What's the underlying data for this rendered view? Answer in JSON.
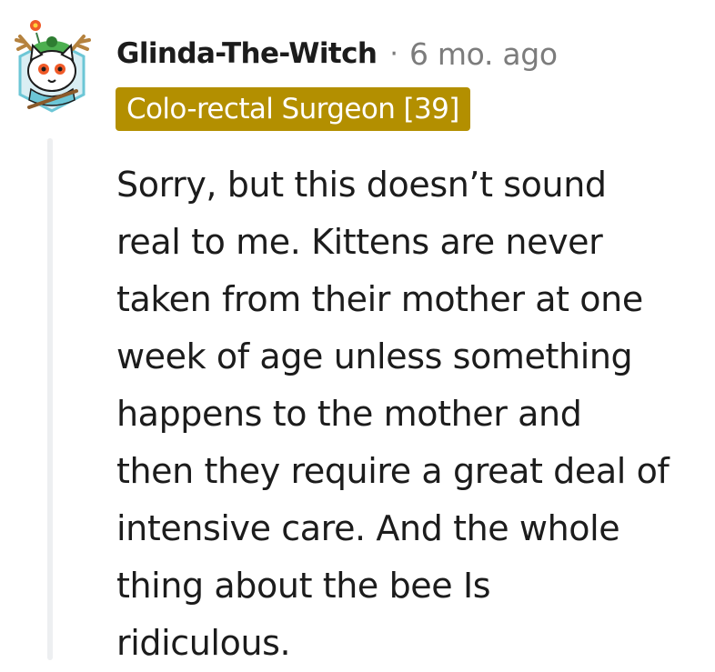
{
  "comment": {
    "author": "Glinda-The-Witch",
    "separator": "·",
    "timestamp": "6 mo. ago",
    "flair": "Colo-rectal Surgeon [39]",
    "body_lines": [
      "Sorry, but this doesn’t sound",
      "real to me. Kittens are never",
      "taken from their mother at one",
      "week of age unless something",
      "happens to the mother and",
      "then they require a great deal of",
      "intensive care. And the whole",
      "thing about the bee Is",
      "ridiculous."
    ]
  },
  "colors": {
    "flair_background": "#b38f00",
    "flair_text": "#ffffff",
    "meta_text": "#7c7c7c",
    "body_text": "#1c1c1c",
    "thread_line": "#edeff1"
  },
  "icons": {
    "avatar": "snoo-avatar-cat-with-antlers"
  }
}
